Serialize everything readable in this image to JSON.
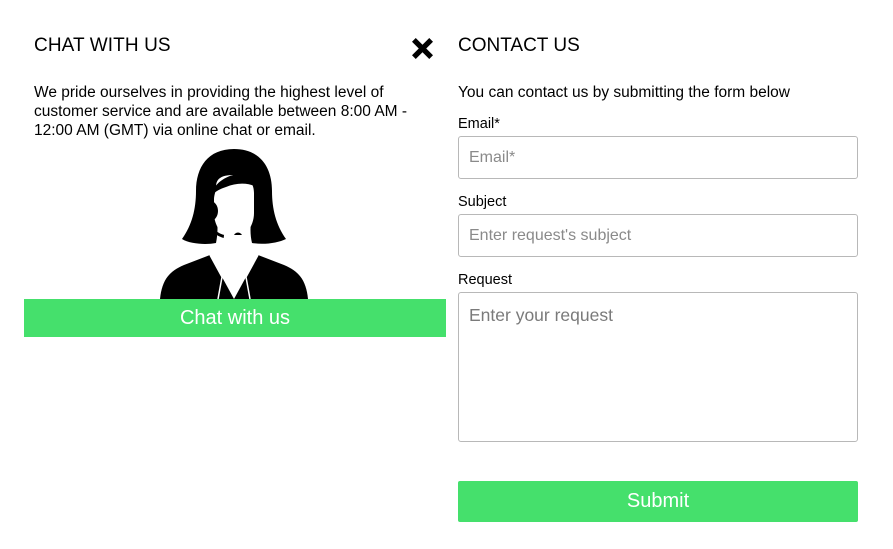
{
  "chat": {
    "title": "CHAT WITH US",
    "description": "We pride ourselves in providing the highest level of customer service and are available between 8:00 AM - 12:00 AM (GMT) via online chat or email.",
    "button_label": "Chat with us",
    "illustration_icon": "support-agent-headset-icon"
  },
  "close": {
    "icon": "close-icon"
  },
  "contact": {
    "title": "CONTACT US",
    "description": "You can contact us by submitting the form below",
    "email": {
      "label": "Email*",
      "placeholder": "Email*",
      "value": ""
    },
    "subject": {
      "label": "Subject",
      "placeholder": "Enter request's subject",
      "value": ""
    },
    "request": {
      "label": "Request",
      "placeholder": "Enter your request",
      "value": ""
    },
    "submit_label": "Submit"
  },
  "colors": {
    "accent_green": "#45e06c",
    "input_border": "#b8b8b8",
    "text": "#000000"
  }
}
